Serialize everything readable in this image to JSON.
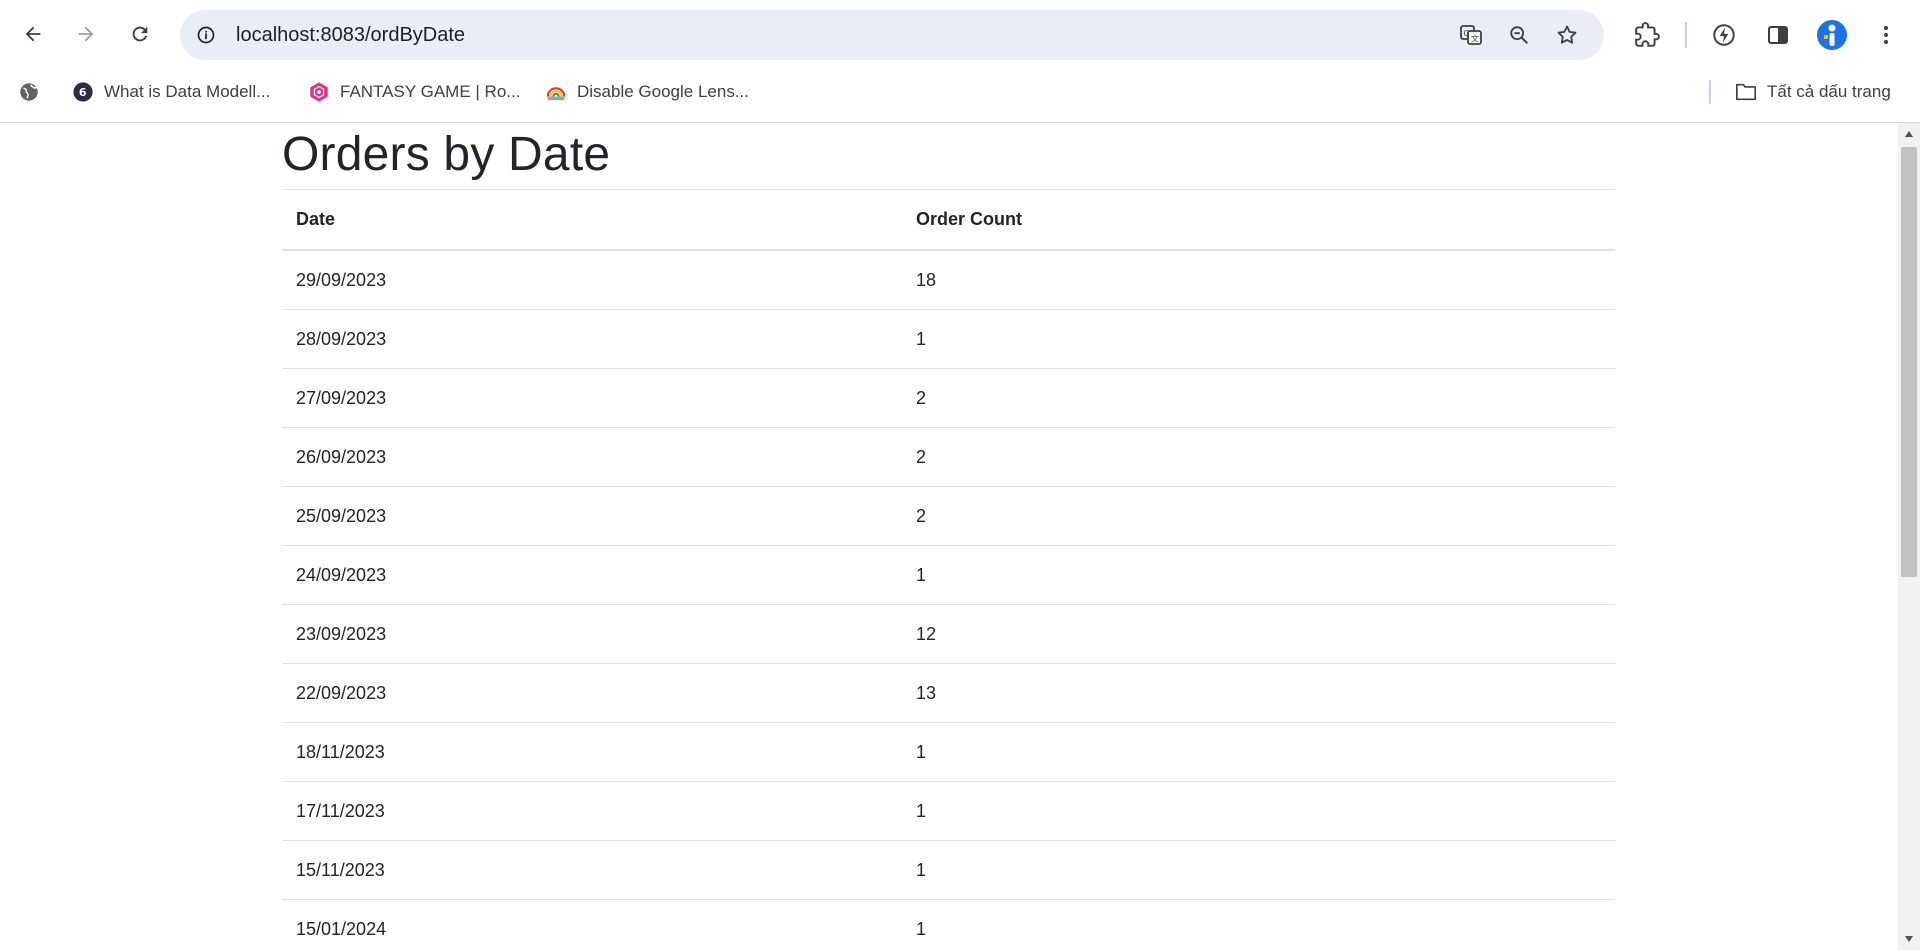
{
  "browser": {
    "url": "localhost:8083/ordByDate",
    "bookmarks": [
      {
        "label": "What is Data Modell...",
        "icon": "g-icon"
      },
      {
        "label": "FANTASY GAME | Ro...",
        "icon": "fantasy-icon"
      },
      {
        "label": "Disable Google Lens...",
        "icon": "rainbow-icon"
      }
    ],
    "bookmarks_folder": "Tất cả dấu trang"
  },
  "page": {
    "title": "Orders by Date",
    "columns": [
      "Date",
      "Order Count"
    ],
    "rows": [
      {
        "date": "29/09/2023",
        "count": "18"
      },
      {
        "date": "28/09/2023",
        "count": "1"
      },
      {
        "date": "27/09/2023",
        "count": "2"
      },
      {
        "date": "26/09/2023",
        "count": "2"
      },
      {
        "date": "25/09/2023",
        "count": "2"
      },
      {
        "date": "24/09/2023",
        "count": "1"
      },
      {
        "date": "23/09/2023",
        "count": "12"
      },
      {
        "date": "22/09/2023",
        "count": "13"
      },
      {
        "date": "18/11/2023",
        "count": "1"
      },
      {
        "date": "17/11/2023",
        "count": "1"
      },
      {
        "date": "15/11/2023",
        "count": "1"
      },
      {
        "date": "15/01/2024",
        "count": "1"
      }
    ]
  }
}
